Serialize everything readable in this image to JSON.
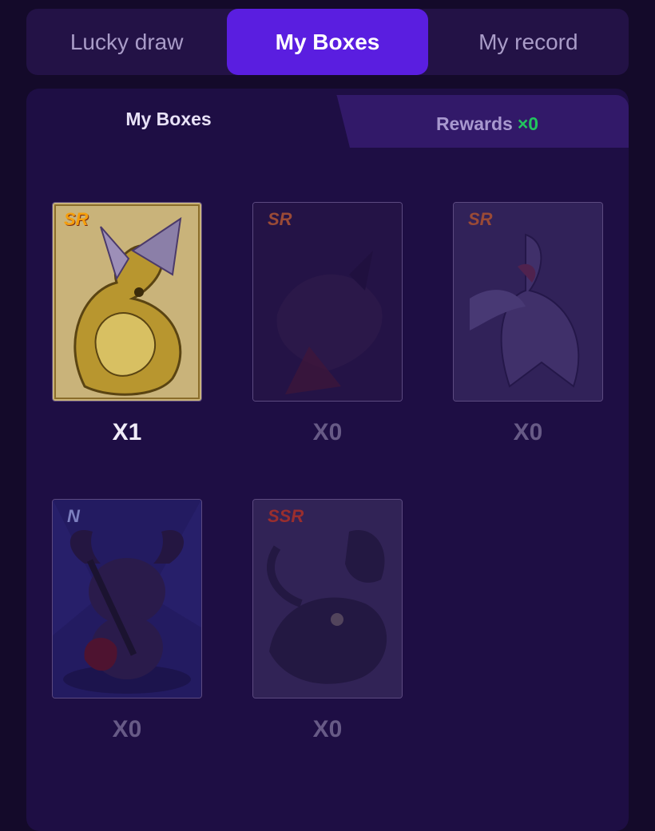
{
  "top_tabs": [
    {
      "label": "Lucky draw",
      "active": false
    },
    {
      "label": "My Boxes",
      "active": true
    },
    {
      "label": "My record",
      "active": false
    }
  ],
  "sub_tabs": {
    "mine": "My Boxes",
    "rewards": "Rewards",
    "rewards_count": "×0"
  },
  "cards": [
    {
      "rarity": "SR",
      "count": "X1",
      "art": "golden-dragon-card-art",
      "owned": true
    },
    {
      "rarity": "SR",
      "count": "X0",
      "art": "dark-demon-card-art",
      "owned": false
    },
    {
      "rarity": "SR",
      "count": "X0",
      "art": "phoenix-bird-card-art",
      "owned": false
    },
    {
      "rarity": "N",
      "count": "X0",
      "art": "buffalo-guitarist-card-art",
      "owned": false
    },
    {
      "rarity": "SSR",
      "count": "X0",
      "art": "black-dragon-card-art",
      "owned": false
    }
  ],
  "colors": {
    "accent": "#5a1ee0",
    "reward_count": "#22c55e"
  }
}
